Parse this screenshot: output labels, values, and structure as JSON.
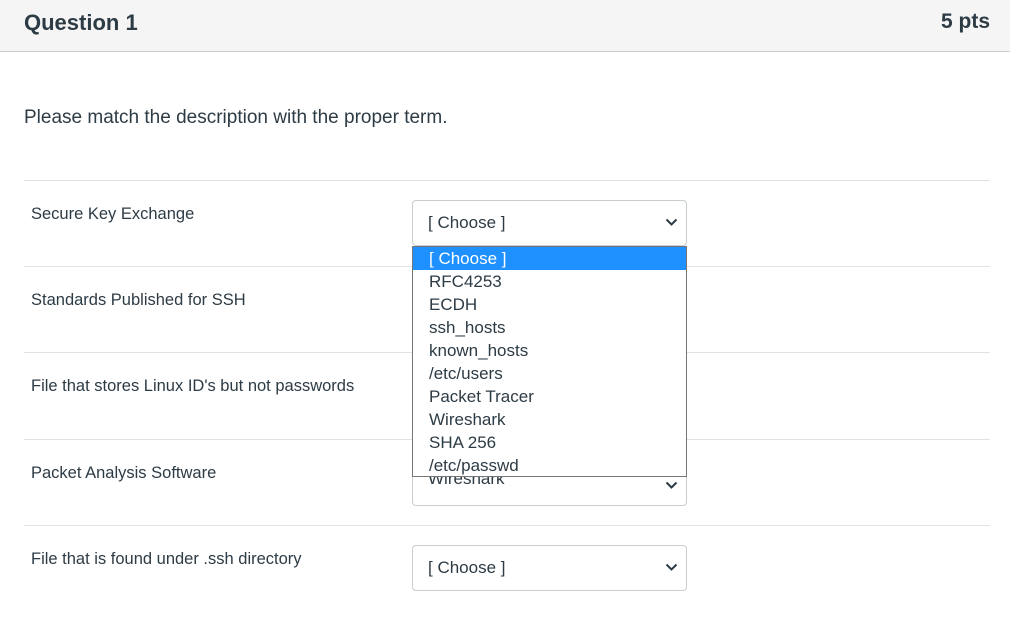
{
  "question": {
    "title": "Question 1",
    "points": "5 pts",
    "prompt": "Please match the description with the proper term."
  },
  "rows": [
    {
      "label": "Secure Key Exchange",
      "selected": "[ Choose ]"
    },
    {
      "label": "Standards Published for SSH",
      "selected": ""
    },
    {
      "label": "File that stores Linux ID's but not passwords",
      "selected": ""
    },
    {
      "label": "Packet Analysis Software",
      "selected": "Wireshark"
    },
    {
      "label": "File that is found under .ssh directory",
      "selected": "[ Choose ]"
    }
  ],
  "dropdown": {
    "options": [
      "[ Choose ]",
      "RFC4253",
      "ECDH",
      "ssh_hosts",
      "known_hosts",
      "/etc/users",
      "Packet Tracer",
      "Wireshark",
      "SHA 256",
      "/etc/passwd"
    ],
    "highlighted_index": 0
  },
  "icons": {
    "select_chevron": "chevron-down-icon"
  },
  "colors": {
    "highlight": "#1e90ff",
    "header_bg": "#f5f5f5",
    "text": "#2d3b45"
  }
}
